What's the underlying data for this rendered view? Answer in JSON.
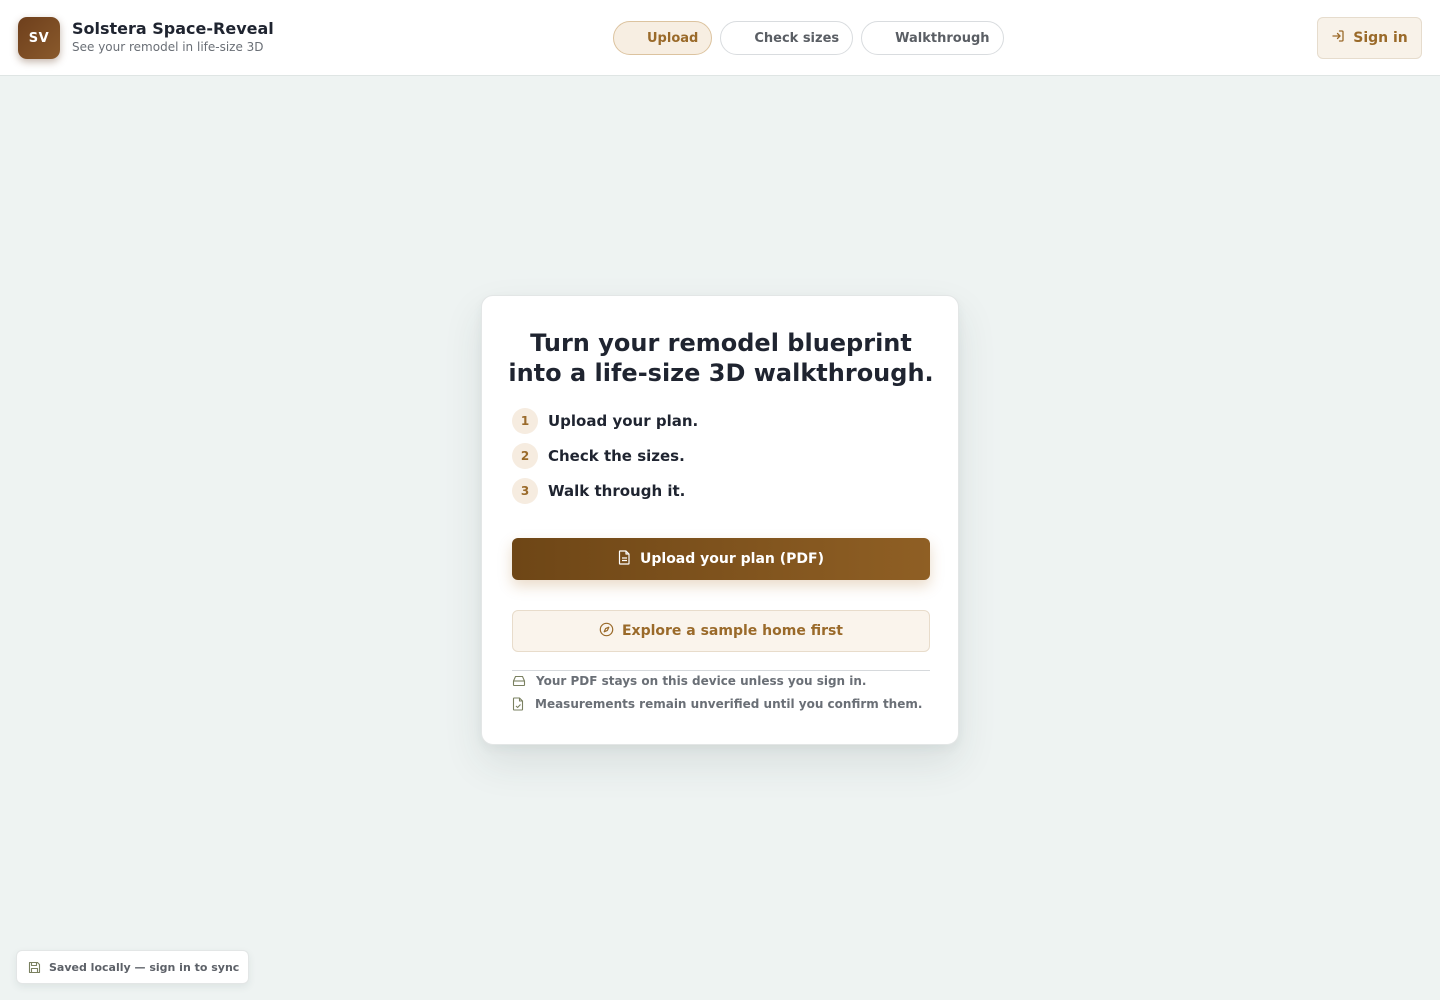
{
  "header": {
    "logo_text": "SV",
    "brand_name": "Solstera Space-Reveal",
    "tagline": "See your remodel in life-size 3D",
    "steps": [
      {
        "label": "Upload",
        "active": true
      },
      {
        "label": "Check sizes",
        "active": false
      },
      {
        "label": "Walkthrough",
        "active": false
      }
    ],
    "signin_label": "Sign in",
    "signin_icon": "sign-in-icon"
  },
  "card": {
    "headline_line1": "Turn your remodel blueprint",
    "headline_line2": "into a life-size 3D walkthrough.",
    "steps": [
      {
        "num": "1",
        "text": "Upload your plan."
      },
      {
        "num": "2",
        "text": "Check the sizes."
      },
      {
        "num": "3",
        "text": "Walk through it."
      }
    ],
    "primary_button": {
      "label": "Upload your plan (PDF)",
      "icon": "document-icon"
    },
    "secondary_button": {
      "label": "Explore a sample home first",
      "icon": "compass-icon"
    },
    "notes": [
      {
        "text": "Your PDF stays on this device unless you sign in.",
        "icon": "drive-icon"
      },
      {
        "text": "Measurements remain unverified until you confirm them.",
        "icon": "file-check-icon"
      }
    ]
  },
  "status": {
    "text": "Saved locally — sign in to sync",
    "icon": "save-icon"
  },
  "colors": {
    "accent": "#9a6a2a",
    "primary_button": "#7a4e1c",
    "background": "#eef3f2"
  }
}
